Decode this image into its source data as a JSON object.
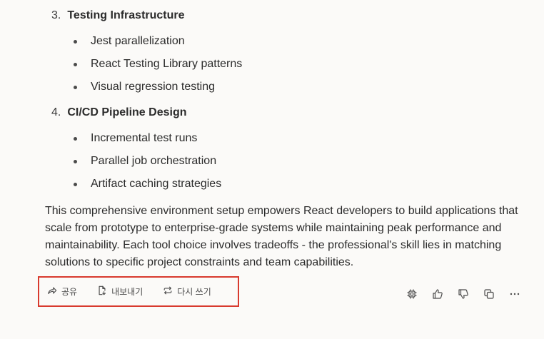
{
  "sections": [
    {
      "number": "3.",
      "title": "Testing Infrastructure",
      "items": [
        "Jest parallelization",
        "React Testing Library patterns",
        "Visual regression testing"
      ]
    },
    {
      "number": "4.",
      "title": "CI/CD Pipeline Design",
      "items": [
        "Incremental test runs",
        "Parallel job orchestration",
        "Artifact caching strategies"
      ]
    }
  ],
  "paragraph": "This comprehensive environment setup empowers React developers to build applications that scale from prototype to enterprise-grade systems while maintaining peak performance and maintainability. Each tool choice involves tradeoffs - the professional's skill lies in matching solutions to specific project constraints and team capabilities.",
  "actions": {
    "share_label": "공유",
    "export_label": "내보내기",
    "rewrite_label": "다시 쓰기"
  },
  "icons": {
    "share": "share-icon",
    "export": "export-icon",
    "rewrite": "rewrite-icon",
    "chip": "chip-icon",
    "thumbs_up": "thumbs-up-icon",
    "thumbs_down": "thumbs-down-icon",
    "copy": "copy-icon",
    "more": "more-icon"
  },
  "colors": {
    "highlight_border": "#d83a2e",
    "background": "#fbfaf8"
  }
}
